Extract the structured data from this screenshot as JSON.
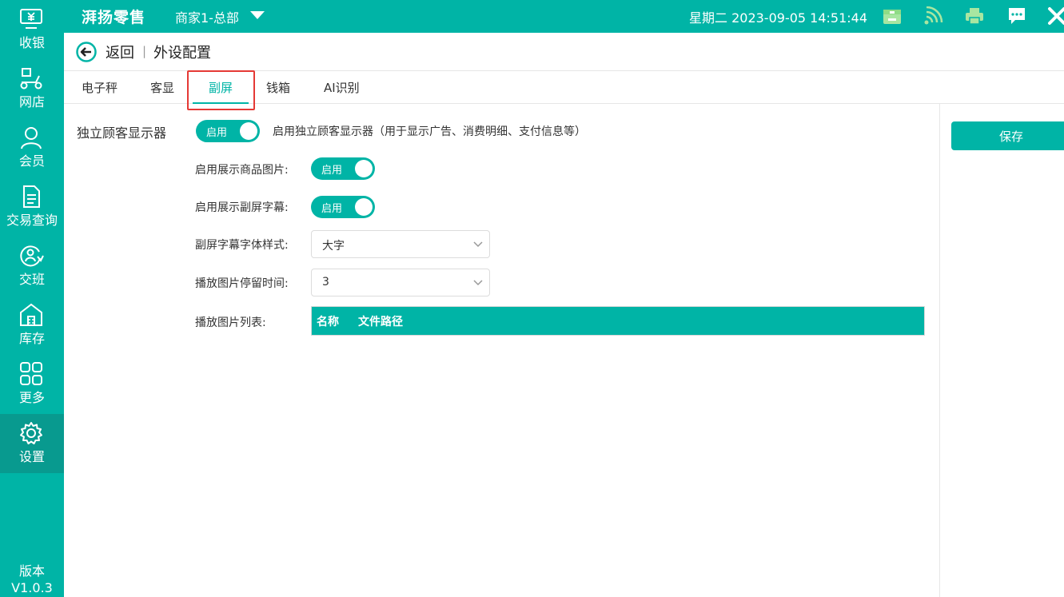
{
  "topbar": {
    "brand": "湃扬零售",
    "store": "商家1-总部",
    "datetime": "星期二 2023-09-05 14:51:44"
  },
  "sidebar": {
    "items": [
      {
        "label": "收银",
        "icon": "cashier-icon"
      },
      {
        "label": "网店",
        "icon": "scooter-icon"
      },
      {
        "label": "会员",
        "icon": "user-icon"
      },
      {
        "label": "交易查询",
        "icon": "document-icon"
      },
      {
        "label": "交班",
        "icon": "shift-icon"
      },
      {
        "label": "库存",
        "icon": "warehouse-icon"
      },
      {
        "label": "更多",
        "icon": "grid-icon"
      },
      {
        "label": "设置",
        "icon": "gear-icon",
        "active": true
      }
    ],
    "version_label": "版本",
    "version": "V1.0.3"
  },
  "header": {
    "back": "返回",
    "separator": "|",
    "title": "外设配置"
  },
  "tabs": [
    {
      "label": "电子秤"
    },
    {
      "label": "客显"
    },
    {
      "label": "副屏",
      "active": true
    },
    {
      "label": "钱箱"
    },
    {
      "label": "AI识别"
    }
  ],
  "form": {
    "main_label": "独立顾客显示器",
    "main_toggle": "启用",
    "main_desc": "启用独立顾客显示器（用于显示广告、消费明细、支付信息等）",
    "show_images_label": "启用展示商品图片:",
    "show_images_toggle": "启用",
    "show_subtitle_label": "启用展示副屏字幕:",
    "show_subtitle_toggle": "启用",
    "font_style_label": "副屏字幕字体样式:",
    "font_style_value": "大字",
    "dwell_time_label": "播放图片停留时间:",
    "dwell_time_value": "3",
    "image_list_label": "播放图片列表:",
    "columns": [
      "名称",
      "文件路径"
    ]
  },
  "actions": {
    "save": "保存"
  },
  "colors": {
    "accent": "#00b4a6",
    "active_nav": "#089a8f",
    "highlight": "#e53935"
  }
}
